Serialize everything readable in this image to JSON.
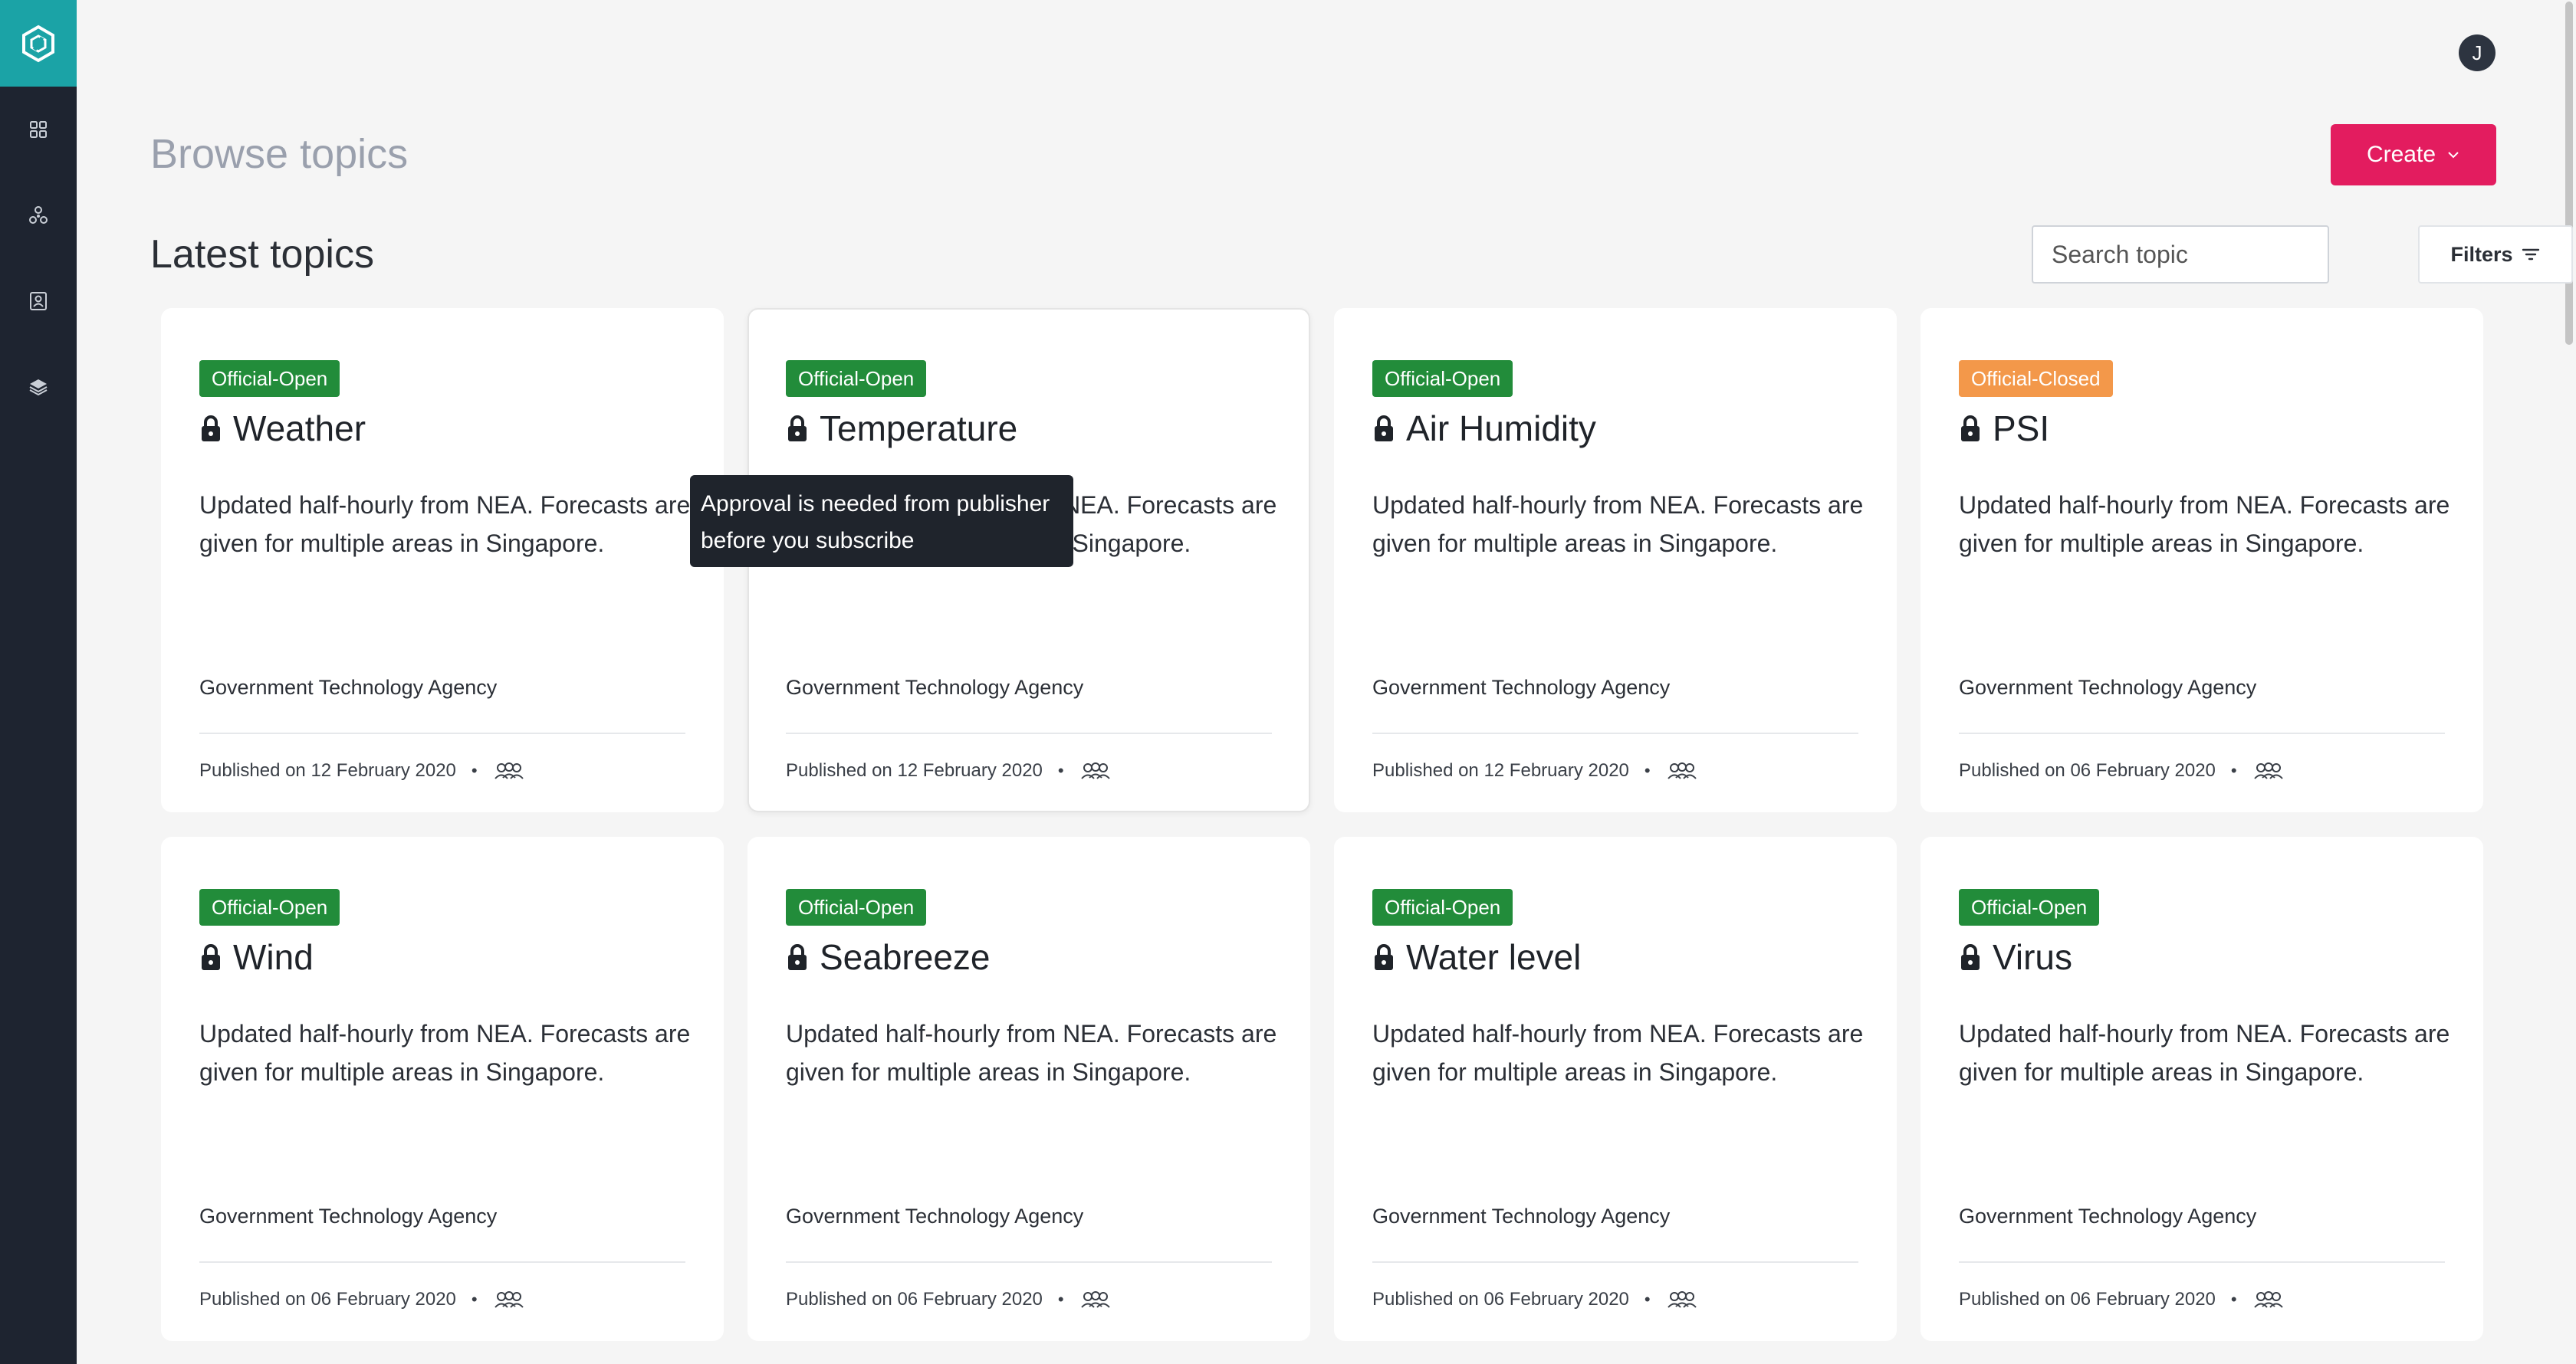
{
  "sidebar": {
    "items": [
      {
        "icon": "dashboard-grid-icon"
      },
      {
        "icon": "network-icon"
      },
      {
        "icon": "contact-book-icon"
      },
      {
        "icon": "layers-icon"
      }
    ]
  },
  "user": {
    "initial": "J"
  },
  "header": {
    "title": "Browse topics",
    "create_label": "Create"
  },
  "section": {
    "title": "Latest topics",
    "search_placeholder": "Search topic",
    "filters_label": "Filters"
  },
  "tooltip": {
    "text": "Approval is needed from publisher before you subscribe"
  },
  "colors": {
    "open_badge": "#228c3a",
    "closed_badge": "#f3984a",
    "create_button": "#e31c5f",
    "logo_bg": "#1ba3a6"
  },
  "cards": [
    {
      "badge": "Official-Open",
      "status": "open",
      "title": "Weather",
      "description": "Updated half-hourly from NEA. Forecasts are given for multiple areas in Singapore.",
      "org": "Government Technology Agency",
      "published": "Published on 12 February 2020"
    },
    {
      "badge": "Official-Open",
      "status": "open",
      "title": "Temperature",
      "description": "Updated half-hourly from NEA. Forecasts are given for multiple areas in Singapore.",
      "org": "Government Technology Agency",
      "published": "Published on 12 February 2020"
    },
    {
      "badge": "Official-Open",
      "status": "open",
      "title": "Air Humidity",
      "description": "Updated half-hourly from NEA. Forecasts are given for multiple areas in Singapore.",
      "org": "Government Technology Agency",
      "published": "Published on 12 February 2020"
    },
    {
      "badge": "Official-Closed",
      "status": "closed",
      "title": "PSI",
      "description": "Updated half-hourly from NEA. Forecasts are given for multiple areas in Singapore.",
      "org": "Government Technology Agency",
      "published": "Published on 06 February 2020"
    },
    {
      "badge": "Official-Open",
      "status": "open",
      "title": "Wind",
      "description": "Updated half-hourly from NEA. Forecasts are given for multiple areas in Singapore.",
      "org": "Government Technology Agency",
      "published": "Published on 06 February 2020"
    },
    {
      "badge": "Official-Open",
      "status": "open",
      "title": "Seabreeze",
      "description": "Updated half-hourly from NEA. Forecasts are given for multiple areas in Singapore.",
      "org": "Government Technology Agency",
      "published": "Published on 06 February 2020"
    },
    {
      "badge": "Official-Open",
      "status": "open",
      "title": "Water level",
      "description": "Updated half-hourly from NEA. Forecasts are given for multiple areas in Singapore.",
      "org": "Government Technology Agency",
      "published": "Published on 06 February 2020"
    },
    {
      "badge": "Official-Open",
      "status": "open",
      "title": "Virus",
      "description": "Updated half-hourly from NEA. Forecasts are given for multiple areas in Singapore.",
      "org": "Government Technology Agency",
      "published": "Published on 06 February 2020"
    }
  ]
}
